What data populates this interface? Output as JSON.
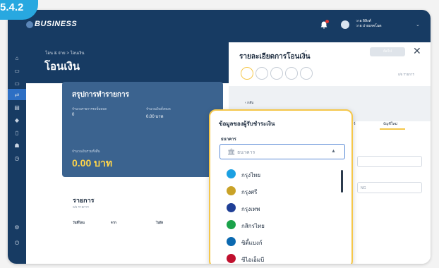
{
  "badge": "5.4.2",
  "app": {
    "logo": "BUSINESS",
    "user_line1": "วาย ลิสิงค์",
    "user_line2": "วาย บ่ายเทคโนต"
  },
  "main": {
    "breadcrumb": "โอน & จ่าย > โอนเงิน",
    "title": "โอนเงิน",
    "summary": {
      "title": "สรุปการทำรายการ",
      "count_label": "จำนวนรายการรอนั้นหมด",
      "count_value": "0",
      "total_label": "จำนวนเงินทั้งหมด",
      "total_value": "0.00 บาท",
      "fee_label": "จำนวนเงินรวมทั้งสิ้น",
      "fee_value": "0.00 บาท"
    },
    "list": {
      "title": "รายการ",
      "subtitle": "0/5 รายการ",
      "columns": [
        "วันที่โอน",
        "จาก",
        "ไปยัง"
      ]
    }
  },
  "detail": {
    "title": "รายละเอียดการโอนเงิน",
    "next_label": "ถัดไป",
    "step_count": "0/5 รายการ",
    "back_label": "กลับ",
    "tabs": [
      "ร์",
      "บัญชีใหม่"
    ],
    "field_hint": "NG"
  },
  "popup": {
    "title": "ข้อมูลของผู้รับชำระเงิน",
    "bank_label": "ธนาคาร",
    "bank_placeholder": "ธนาคาร",
    "banks": [
      {
        "name": "กรุงไทย",
        "color": "#1ba0e2"
      },
      {
        "name": "กรุงศรี",
        "color": "#c9a227"
      },
      {
        "name": "กรุงเทพ",
        "color": "#1f3f96"
      },
      {
        "name": "กสิกรไทย",
        "color": "#1ba24a"
      },
      {
        "name": "ซิตี้แบงก์",
        "color": "#0b69b0"
      },
      {
        "name": "ซีไอเอ็มบี",
        "color": "#c0102e"
      }
    ]
  }
}
